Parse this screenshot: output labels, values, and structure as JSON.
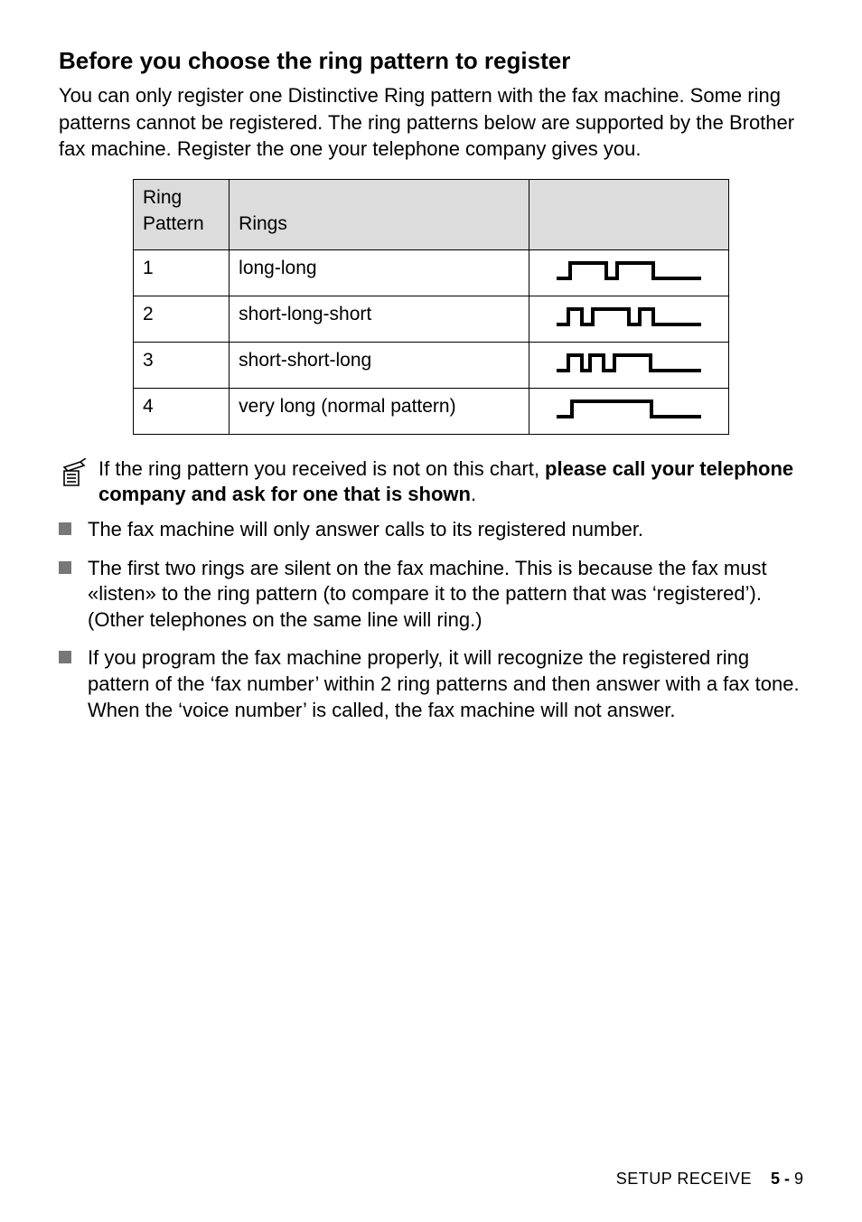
{
  "heading": "Before you choose the ring pattern to register",
  "intro": "You can only register one Distinctive Ring pattern with the fax machine. Some ring patterns cannot be registered. The ring patterns below are supported by the Brother fax machine. Register the one your telephone company gives you.",
  "table": {
    "header_col1_line1": "Ring",
    "header_col1_line2": "Pattern",
    "header_col2": "Rings",
    "rows": [
      {
        "num": "1",
        "name": "long-long"
      },
      {
        "num": "2",
        "name": "short-long-short"
      },
      {
        "num": "3",
        "name": "short-short-long"
      },
      {
        "num": "4",
        "name": "very long (normal pattern)"
      }
    ]
  },
  "note": {
    "prefix": "If the ring pattern you received is not on this chart, ",
    "bold": "please call your telephone company and ask for one that is shown",
    "suffix": "."
  },
  "bullets": [
    "The fax machine will only answer calls to its registered number.",
    "The first two rings are silent on the fax machine. This is because the fax must «listen» to the ring pattern (to compare it to the pattern that was ‘registered’). (Other telephones on the same line will ring.)",
    "If you program the fax machine properly, it will recognize the registered ring pattern of the ‘fax number’ within 2 ring patterns and then answer with a fax tone. When the ‘voice number’ is called, the fax machine will not answer."
  ],
  "footer": {
    "section": "SETUP RECEIVE",
    "page_prefix": "5 - ",
    "page_num": "9"
  }
}
